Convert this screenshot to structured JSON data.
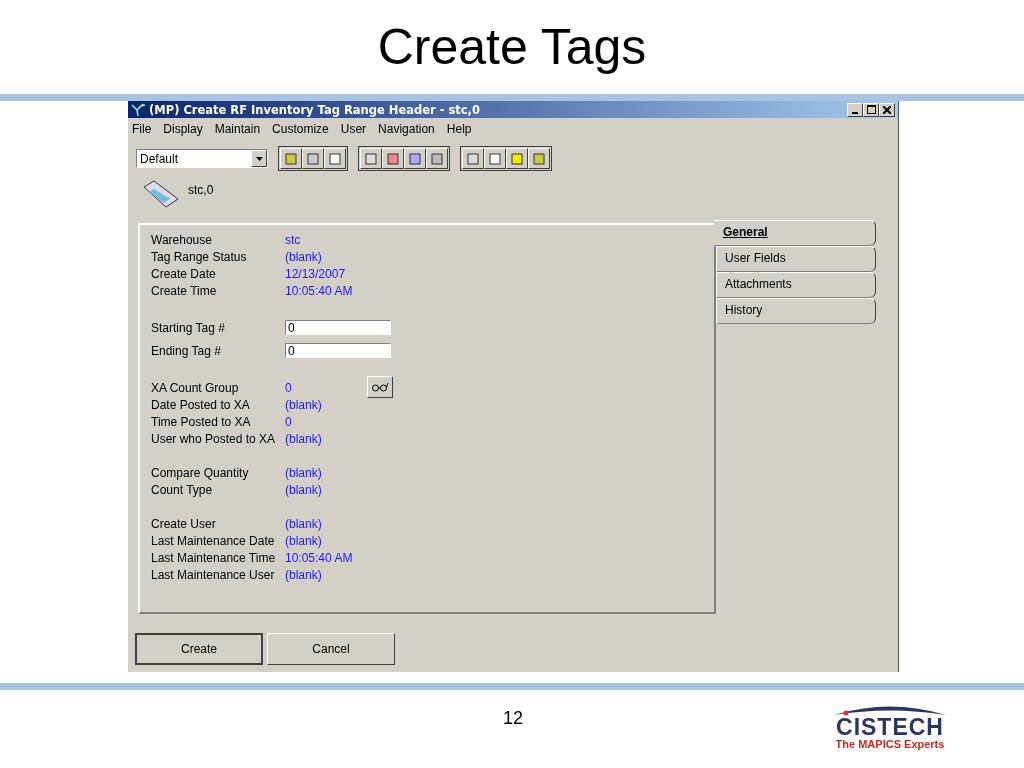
{
  "slide": {
    "title": "Create Tags",
    "page_number": "12"
  },
  "window": {
    "title": "(MP) Create RF Inventory Tag Range Header - stc,0"
  },
  "menu": [
    "File",
    "Display",
    "Maintain",
    "Customize",
    "User",
    "Navigation",
    "Help"
  ],
  "toolbar": {
    "view_select": "Default"
  },
  "header": {
    "label": "stc,0"
  },
  "field_groups": [
    [
      {
        "kind": "text",
        "label": "Warehouse",
        "value": "stc"
      },
      {
        "kind": "text",
        "label": "Tag Range Status",
        "value": "(blank)"
      },
      {
        "kind": "text",
        "label": "Create Date",
        "value": "12/13/2007"
      },
      {
        "kind": "text",
        "label": "Create Time",
        "value": "10:05:40 AM"
      }
    ],
    [
      {
        "kind": "input",
        "label": "Starting Tag #",
        "value": "0"
      },
      {
        "kind": "input",
        "label": "Ending Tag #",
        "value": "0"
      }
    ],
    [
      {
        "kind": "lookup",
        "label": "XA Count Group",
        "value": "0"
      },
      {
        "kind": "text",
        "label": "Date Posted to XA",
        "value": "(blank)"
      },
      {
        "kind": "text",
        "label": "Time Posted to XA",
        "value": "0"
      },
      {
        "kind": "text",
        "label": "User who Posted to XA",
        "value": "(blank)"
      }
    ],
    [
      {
        "kind": "text",
        "label": "Compare Quantity",
        "value": "(blank)"
      },
      {
        "kind": "text",
        "label": "Count Type",
        "value": "(blank)"
      }
    ],
    [
      {
        "kind": "text",
        "label": "Create User",
        "value": "(blank)"
      },
      {
        "kind": "text",
        "label": "Last Maintenance Date",
        "value": "(blank)"
      },
      {
        "kind": "text",
        "label": "Last Maintenance Time",
        "value": "10:05:40 AM"
      },
      {
        "kind": "text",
        "label": "Last Maintenance User",
        "value": "(blank)"
      }
    ]
  ],
  "tabs": [
    {
      "label": "General",
      "selected": true
    },
    {
      "label": "User Fields",
      "selected": false
    },
    {
      "label": "Attachments",
      "selected": false
    },
    {
      "label": "History",
      "selected": false
    }
  ],
  "buttons": [
    "Create",
    "Cancel"
  ],
  "logo": {
    "name": "CISTECH",
    "tagline": "The MAPICS Experts"
  }
}
